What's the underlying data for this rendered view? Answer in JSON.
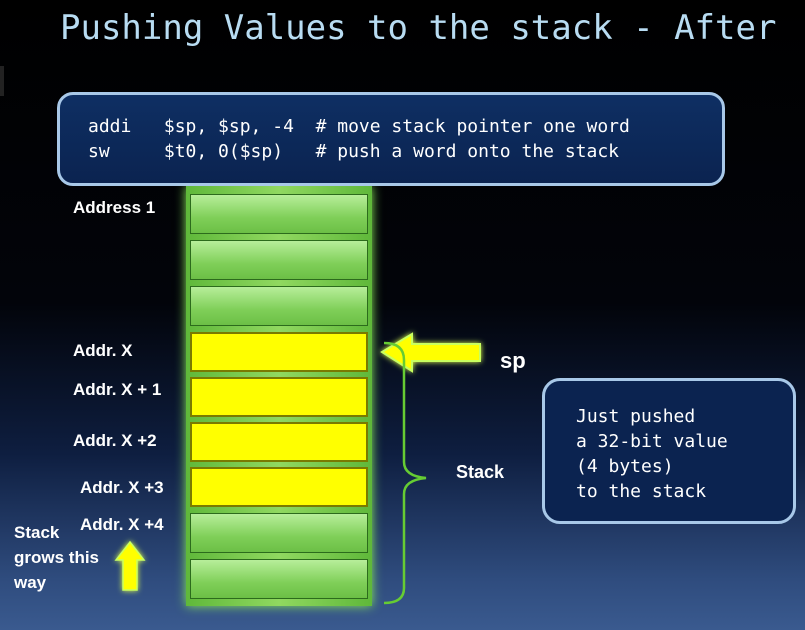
{
  "slide": {
    "title": "Pushing Values to the stack - After"
  },
  "code_box": {
    "line1": "addi   $sp, $sp, -4  # move stack pointer one word",
    "line2": "sw     $t0, 0($sp)   # push a word onto the stack"
  },
  "stack": {
    "cells": [
      {
        "color": "green"
      },
      {
        "color": "green"
      },
      {
        "color": "green"
      },
      {
        "color": "yellow"
      },
      {
        "color": "yellow"
      },
      {
        "color": "yellow"
      },
      {
        "color": "yellow"
      },
      {
        "color": "green"
      },
      {
        "color": "green"
      }
    ]
  },
  "address_labels": {
    "address1": "Address 1",
    "addr_x": "Addr. X",
    "addr_x1": "Addr. X + 1",
    "addr_x2": "Addr. X +2",
    "addr_x3": "Addr. X +3",
    "addr_x4": "Addr. X +4"
  },
  "labels": {
    "sp": "sp",
    "stack": "Stack",
    "grows_line1": "Stack",
    "grows_line2": "grows this",
    "grows_line3": "way"
  },
  "note_box": {
    "line1": "Just pushed",
    "line2": "a 32-bit value",
    "line3": "(4 bytes)",
    "line4": "to the stack"
  },
  "colors": {
    "title": "#b8dcf2",
    "cell_green": "#8fd868",
    "cell_yellow": "#ffff00",
    "box_fill": "#0b2350",
    "box_border": "#a8c8e8",
    "arrow_yellow": "#ffff00"
  }
}
